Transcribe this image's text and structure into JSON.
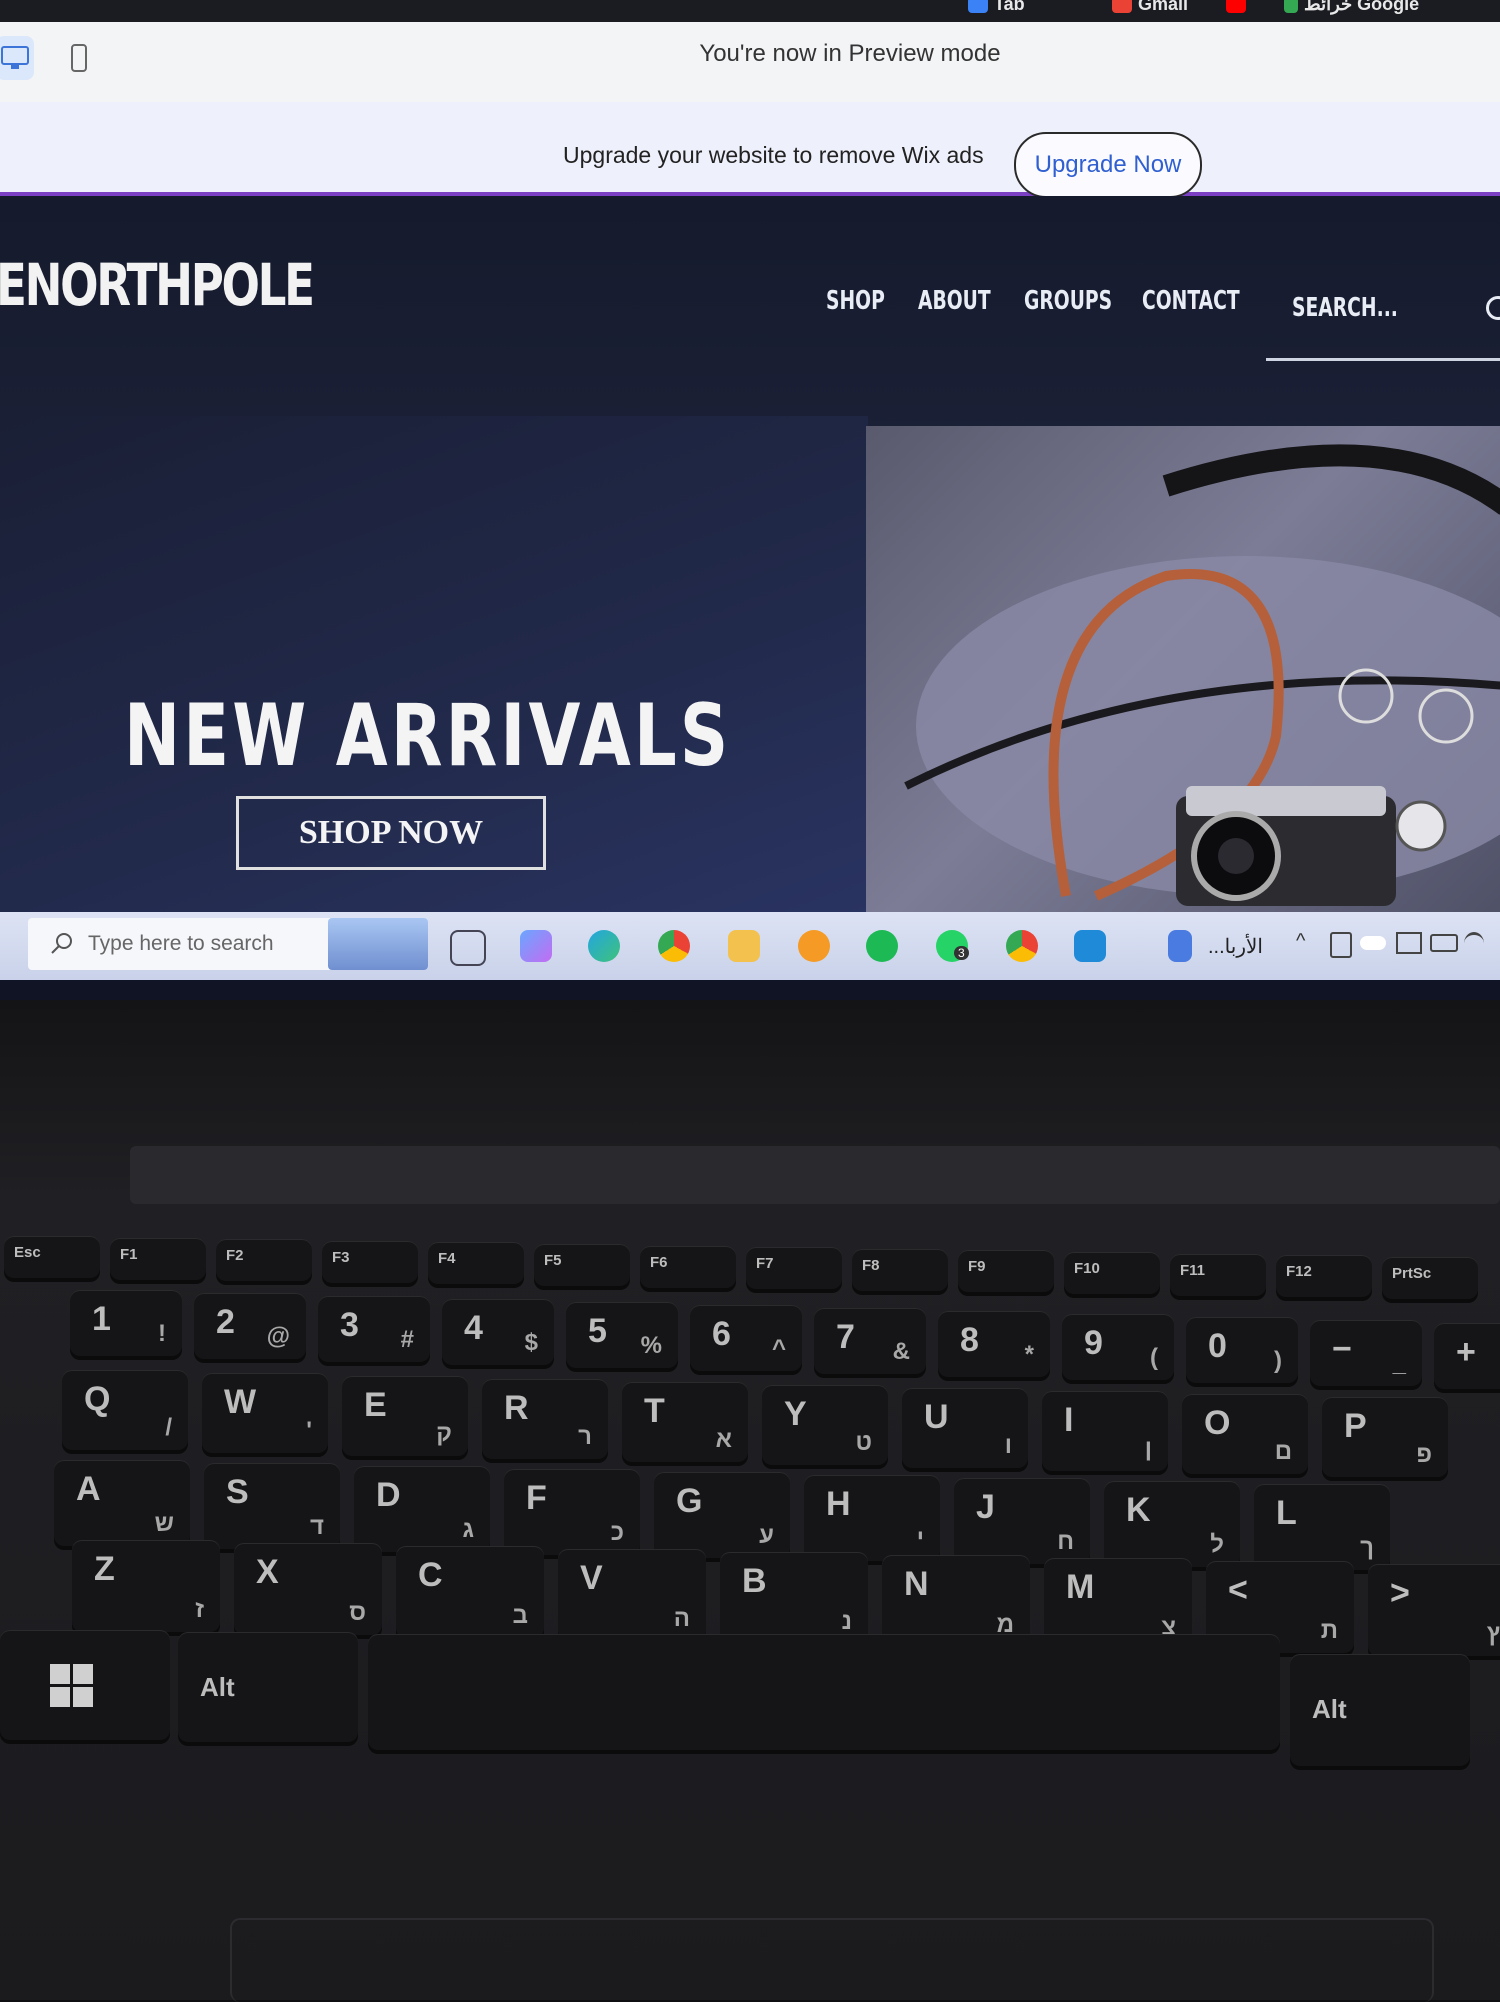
{
  "browser": {
    "bookmarks": [
      {
        "label": "Tab",
        "icon": "browser-tab-icon",
        "color": "#3b82f6"
      },
      {
        "label": "Gmail",
        "icon": "gmail-icon",
        "color": "#ea4335"
      },
      {
        "label": "",
        "icon": "youtube-icon",
        "color": "#ff0000"
      },
      {
        "label": "خرائط Google",
        "icon": "google-maps-icon",
        "color": "#34a853"
      }
    ]
  },
  "preview_bar": {
    "message": "You're now in Preview mode",
    "desktop_icon": "desktop-icon",
    "mobile_icon": "mobile-icon"
  },
  "wix_bar": {
    "message": "Upgrade your website to remove Wix ads",
    "upgrade_label": "Upgrade Now",
    "accent": "#7b3fc4"
  },
  "site": {
    "logo": "ENORTHPOLE",
    "nav": [
      "SHOP",
      "ABOUT",
      "GROUPS",
      "CONTACT"
    ],
    "search_placeholder": "SEARCH...",
    "hero_title": "NEW ARRIVALS",
    "cta_label": "SHOP NOW"
  },
  "taskbar": {
    "search_placeholder": "Type here to search",
    "apps": [
      "task-view-icon",
      "copilot-icon",
      "edge-icon",
      "chrome-icon",
      "file-explorer-icon",
      "cloud-app-icon",
      "spotify-icon",
      "whatsapp-icon",
      "chrome-alt-icon",
      "vscode-icon"
    ],
    "whatsapp_badge": "3",
    "tray_label": "...الأربا"
  },
  "keyboard": {
    "fn_row": [
      "Esc",
      "F1",
      "F2",
      "F3",
      "F4",
      "F5",
      "F6",
      "F7",
      "F8",
      "F9",
      "F10",
      "F11",
      "F12",
      "PrtSc"
    ],
    "number_row": [
      {
        "main": "1",
        "sub": "!"
      },
      {
        "main": "2",
        "sub": "@"
      },
      {
        "main": "3",
        "sub": "#"
      },
      {
        "main": "4",
        "sub": "$"
      },
      {
        "main": "5",
        "sub": "%"
      },
      {
        "main": "6",
        "sub": "^"
      },
      {
        "main": "7",
        "sub": "&"
      },
      {
        "main": "8",
        "sub": "*"
      },
      {
        "main": "9",
        "sub": "("
      },
      {
        "main": "0",
        "sub": ")"
      },
      {
        "main": "−",
        "sub": "_"
      },
      {
        "main": "+",
        "sub": "="
      }
    ],
    "row_q": [
      {
        "main": "Q",
        "sub": "/"
      },
      {
        "main": "W",
        "sub": "'"
      },
      {
        "main": "E",
        "sub": "ק"
      },
      {
        "main": "R",
        "sub": "ר"
      },
      {
        "main": "T",
        "sub": "א"
      },
      {
        "main": "Y",
        "sub": "ט"
      },
      {
        "main": "U",
        "sub": "ו"
      },
      {
        "main": "I",
        "sub": "ן"
      },
      {
        "main": "O",
        "sub": "ם"
      },
      {
        "main": "P",
        "sub": "פ"
      }
    ],
    "row_a": [
      {
        "main": "A",
        "sub": "ש"
      },
      {
        "main": "S",
        "sub": "ד"
      },
      {
        "main": "D",
        "sub": "ג"
      },
      {
        "main": "F",
        "sub": "כ"
      },
      {
        "main": "G",
        "sub": "ע"
      },
      {
        "main": "H",
        "sub": "י"
      },
      {
        "main": "J",
        "sub": "ח"
      },
      {
        "main": "K",
        "sub": "ל"
      },
      {
        "main": "L",
        "sub": "ך"
      }
    ],
    "row_z": [
      {
        "main": "Z",
        "sub": "ז"
      },
      {
        "main": "X",
        "sub": "ס"
      },
      {
        "main": "C",
        "sub": "ב"
      },
      {
        "main": "V",
        "sub": "ה"
      },
      {
        "main": "B",
        "sub": "נ"
      },
      {
        "main": "N",
        "sub": "מ"
      },
      {
        "main": "M",
        "sub": "צ"
      },
      {
        "main": "<",
        "sub": "ת"
      },
      {
        "main": ">",
        "sub": "ץ"
      }
    ],
    "alt_left": "Alt",
    "alt_right": "Alt"
  }
}
